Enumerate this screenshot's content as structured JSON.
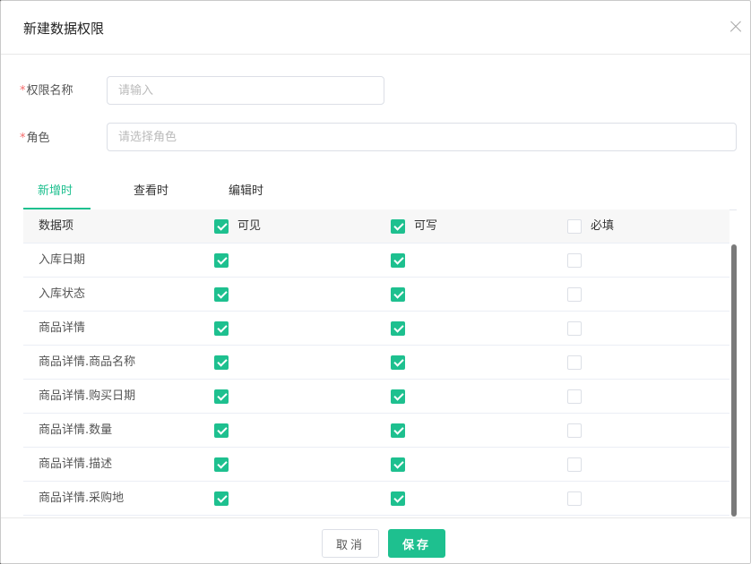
{
  "dialog": {
    "title": "新建数据权限",
    "close_icon": "close-icon"
  },
  "form": {
    "name": {
      "required_mark": "*",
      "label": "权限名称",
      "placeholder": "请输入",
      "value": ""
    },
    "role": {
      "required_mark": "*",
      "label": "角色",
      "placeholder": "请选择角色",
      "value": ""
    }
  },
  "tabs": [
    {
      "label": "新增时",
      "active": true
    },
    {
      "label": "查看时",
      "active": false
    },
    {
      "label": "编辑时",
      "active": false
    }
  ],
  "table": {
    "headers": {
      "item": "数据项",
      "visible": {
        "label": "可见",
        "checked": true
      },
      "writable": {
        "label": "可写",
        "checked": true
      },
      "required": {
        "label": "必填",
        "checked": false
      }
    },
    "rows": [
      {
        "name": "入库日期",
        "visible": true,
        "writable": true,
        "required": false
      },
      {
        "name": "入库状态",
        "visible": true,
        "writable": true,
        "required": false
      },
      {
        "name": "商品详情",
        "visible": true,
        "writable": true,
        "required": false
      },
      {
        "name": "商品详情.商品名称",
        "visible": true,
        "writable": true,
        "required": false
      },
      {
        "name": "商品详情.购买日期",
        "visible": true,
        "writable": true,
        "required": false
      },
      {
        "name": "商品详情.数量",
        "visible": true,
        "writable": true,
        "required": false
      },
      {
        "name": "商品详情.描述",
        "visible": true,
        "writable": true,
        "required": false
      },
      {
        "name": "商品详情.采购地",
        "visible": true,
        "writable": true,
        "required": false
      }
    ]
  },
  "footer": {
    "cancel_label": "取消",
    "save_label": "保存"
  },
  "colors": {
    "accent": "#1ec08f",
    "required": "#f56c6c"
  }
}
